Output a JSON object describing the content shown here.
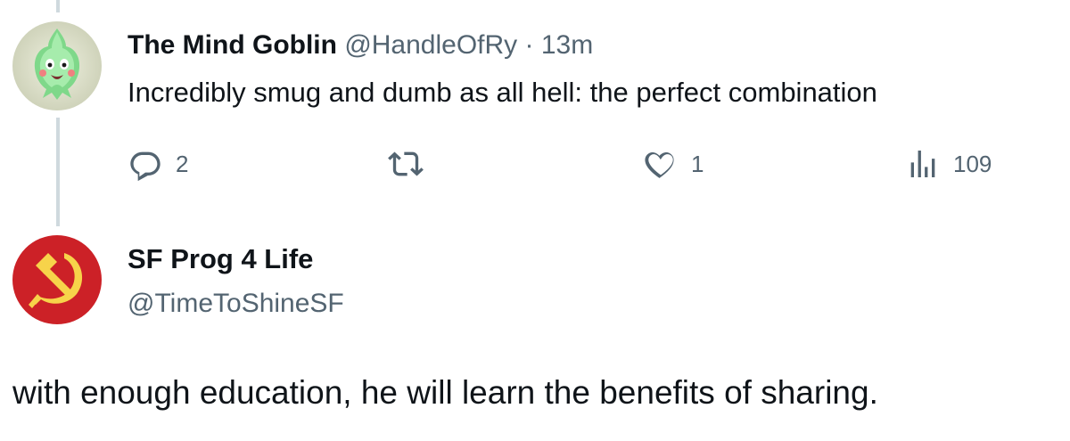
{
  "tweet1": {
    "display_name": "The Mind Goblin",
    "handle": "@HandleOfRy",
    "separator": "·",
    "time": "13m",
    "text": "Incredibly smug and dumb as all hell: the perfect combination",
    "avatar_icon": "ghost-goblin-avatar",
    "actions": {
      "reply_count": "2",
      "retweet_count": "",
      "like_count": "1",
      "views_count": "109"
    }
  },
  "tweet2": {
    "display_name": "SF Prog 4 Life",
    "handle": "@TimeToShineSF",
    "text": "with enough education, he will learn the benefits of sharing.",
    "avatar_icon": "hammer-sickle-avatar"
  },
  "colors": {
    "text_primary": "#0f1419",
    "text_secondary": "#536471",
    "thread_line": "#cfd9de",
    "avatar_red": "#cc2127",
    "avatar_yellow": "#f7d34a"
  }
}
